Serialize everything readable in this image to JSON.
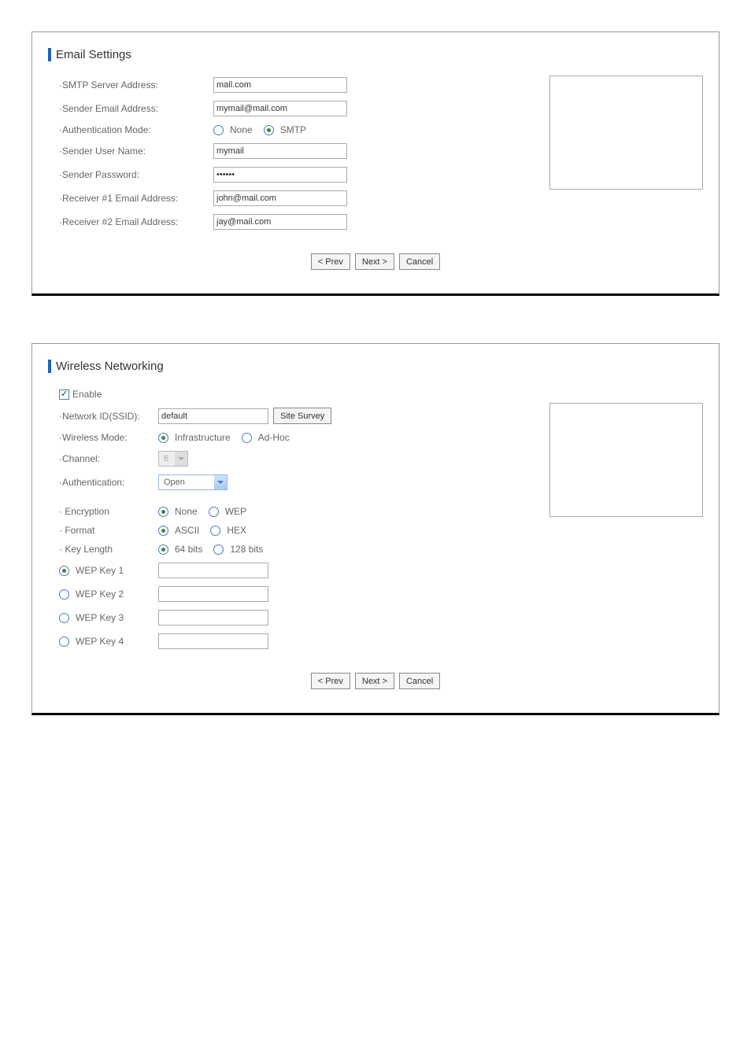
{
  "email": {
    "title": "Email Settings",
    "labels": {
      "smtp": "·SMTP Server Address:",
      "sender_email": "·Sender Email Address:",
      "auth_mode": "·Authentication Mode:",
      "sender_user": "·Sender User Name:",
      "sender_pass": "·Sender Password:",
      "rcv1": "·Receiver #1 Email Address:",
      "rcv2": "·Receiver #2 Email Address:"
    },
    "values": {
      "smtp": "mail.com",
      "sender_email": "mymail@mail.com",
      "sender_user": "mymail",
      "sender_pass": "••••••",
      "rcv1": "john@mail.com",
      "rcv2": "jay@mail.com"
    },
    "auth": {
      "none": "None",
      "smtp": "SMTP"
    }
  },
  "wireless": {
    "title": "Wireless Networking",
    "enable_label": "Enable",
    "labels": {
      "ssid": "·Network ID(SSID):",
      "mode": "·Wireless Mode:",
      "channel": "·Channel:",
      "auth": "·Authentication:",
      "encryption": "· Encryption",
      "format": "· Format",
      "keylen": "· Key Length",
      "wep1": "WEP Key 1",
      "wep2": "WEP Key 2",
      "wep3": "WEP Key 3",
      "wep4": "WEP Key 4"
    },
    "values": {
      "ssid": "default",
      "channel": "6",
      "auth": "Open"
    },
    "mode": {
      "infra": "Infrastructure",
      "adhoc": "Ad-Hoc"
    },
    "encryption": {
      "none": "None",
      "wep": "WEP"
    },
    "format": {
      "ascii": "ASCII",
      "hex": "HEX"
    },
    "keylen": {
      "k64": "64 bits",
      "k128": "128 bits"
    },
    "site_survey": "Site Survey"
  },
  "buttons": {
    "prev": "< Prev",
    "next": "Next >",
    "cancel": "Cancel"
  }
}
